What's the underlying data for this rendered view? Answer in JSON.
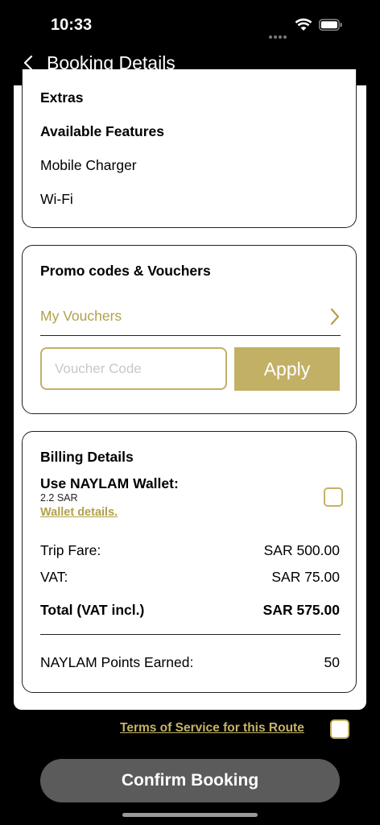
{
  "status": {
    "time": "10:33"
  },
  "header": {
    "title": "Booking Details"
  },
  "extras": {
    "title": "Extras",
    "features_title": "Available Features",
    "features": [
      "Mobile Charger",
      "Wi-Fi"
    ]
  },
  "promo": {
    "title": "Promo codes & Vouchers",
    "my_vouchers": "My Vouchers",
    "voucher_placeholder": "Voucher Code",
    "apply_label": "Apply"
  },
  "billing": {
    "title": "Billing Details",
    "wallet_label": "Use NAYLAM Wallet:",
    "wallet_amount": "2.2 SAR",
    "wallet_details": "Wallet details.",
    "trip_fare_label": "Trip Fare:",
    "trip_fare_value": "SAR 500.00",
    "vat_label": "VAT:",
    "vat_value": "SAR 75.00",
    "total_label": "Total (VAT incl.)",
    "total_value": "SAR 575.00",
    "points_label": "NAYLAM Points Earned:",
    "points_value": "50"
  },
  "footer": {
    "terms_label": "Terms of Service for this Route",
    "confirm_label": "Confirm Booking"
  },
  "colors": {
    "accent": "#c2b065",
    "button_disabled": "#5b5b5b"
  }
}
